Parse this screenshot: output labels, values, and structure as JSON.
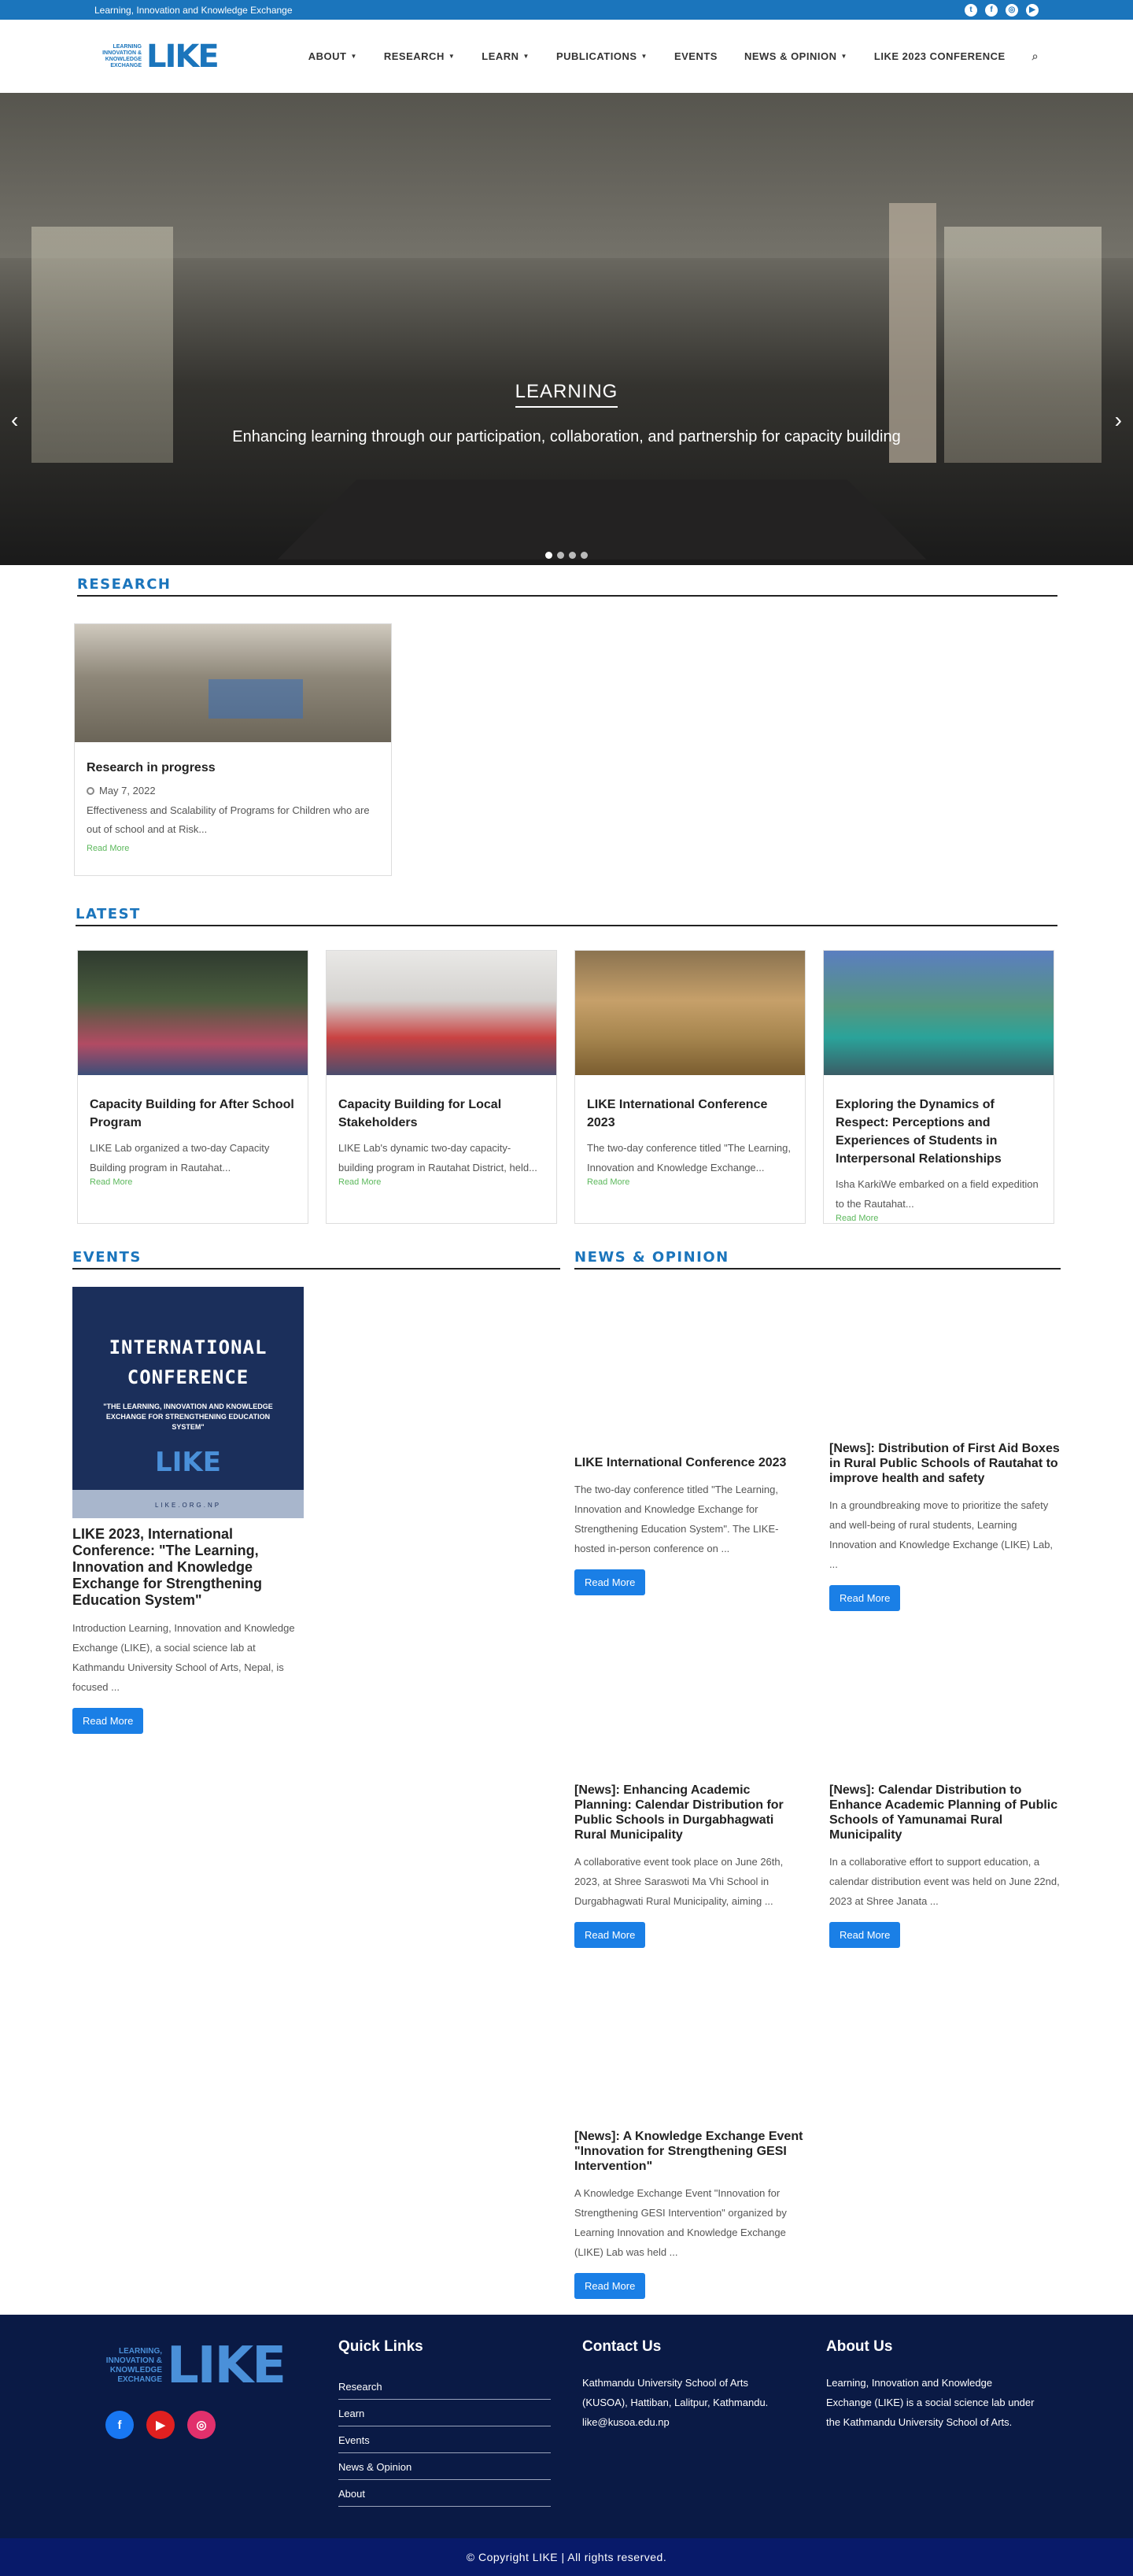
{
  "topbar": {
    "tagline": "Learning, Innovation and Knowledge Exchange",
    "socials": [
      "twitter-icon",
      "facebook-icon",
      "instagram-icon",
      "youtube-icon"
    ]
  },
  "header": {
    "logo_text": "LEARNING INNOVATION & KNOWLEDGE EXCHANGE",
    "logo_mark": "LIKE",
    "nav": [
      {
        "label": "ABOUT",
        "caret": true
      },
      {
        "label": "RESEARCH",
        "caret": true
      },
      {
        "label": "LEARN",
        "caret": true
      },
      {
        "label": "PUBLICATIONS",
        "caret": true
      },
      {
        "label": "EVENTS",
        "caret": false
      },
      {
        "label": "NEWS & OPINION",
        "caret": true
      },
      {
        "label": "LIKE 2023 CONFERENCE",
        "caret": false
      }
    ]
  },
  "hero": {
    "title": "LEARNING",
    "subtitle": "Enhancing learning through our participation, collaboration, and partnership for capacity building",
    "slides": 4,
    "active_slide": 1
  },
  "research": {
    "heading": "RESEARCH",
    "card": {
      "title": "Research in progress",
      "date": "May 7, 2022",
      "excerpt": "Effectiveness and Scalability of Programs for Children who are out of school and at Risk...",
      "read_more": "Read More"
    }
  },
  "latest": {
    "heading": "LATEST",
    "cards": [
      {
        "title": "Capacity Building for After School Program",
        "excerpt": "LIKE Lab organized a two-day Capacity Building program in Rautahat...",
        "read_more": "Read More"
      },
      {
        "title": "Capacity Building for Local Stakeholders",
        "excerpt": "LIKE Lab's dynamic two-day capacity-building program in Rautahat District, held...",
        "read_more": "Read More"
      },
      {
        "title": "LIKE International Conference 2023",
        "excerpt": "The two-day conference titled \"The Learning, Innovation and Knowledge Exchange...",
        "read_more": "Read More"
      },
      {
        "title": "Exploring the Dynamics of Respect: Perceptions and Experiences of Students in Interpersonal Relationships",
        "excerpt": "Isha KarkiWe embarked on a field expedition to the Rautahat...",
        "read_more": "Read More"
      }
    ]
  },
  "events": {
    "heading": "EVENTS",
    "poster": {
      "line1": "INTERNATIONAL",
      "line2": "CONFERENCE",
      "line3": "\"THE LEARNING, INNOVATION AND KNOWLEDGE EXCHANGE FOR STRENGTHENING EDUCATION SYSTEM\"",
      "mark": "LIKE",
      "url": "LIKE.ORG.NP"
    },
    "title": "LIKE 2023, International Conference: \"The Learning, Innovation and Knowledge Exchange for Strengthening Education System\"",
    "excerpt": "Introduction Learning, Innovation and Knowledge Exchange (LIKE), a social science lab at Kathmandu University School of Arts, Nepal, is focused ...",
    "button": "Read More"
  },
  "news": {
    "heading": "NEWS & OPINION",
    "items": [
      {
        "title": "LIKE International Conference 2023",
        "excerpt": "The two-day conference titled \"The Learning, Innovation and Knowledge Exchange for Strengthening Education System\". The LIKE-hosted in-person conference on ...",
        "button": "Read More"
      },
      {
        "title": "[News]: Distribution of First Aid Boxes in Rural Public Schools of Rautahat to improve health and safety",
        "excerpt": "In a groundbreaking move to prioritize the safety and well-being of rural students, Learning Innovation and Knowledge Exchange (LIKE) Lab, ...",
        "button": "Read More"
      },
      {
        "title": "[News]: Enhancing Academic Planning: Calendar Distribution for Public Schools in Durgabhagwati Rural Municipality",
        "excerpt": "A collaborative event took place on June 26th, 2023, at Shree Saraswoti Ma Vhi School in Durgabhagwati Rural Municipality, aiming ...",
        "button": "Read More"
      },
      {
        "title": "[News]: Calendar Distribution to Enhance Academic Planning of Public Schools of Yamunamai Rural Municipality",
        "excerpt": "In a collaborative effort to support education, a calendar distribution event was held on June 22nd, 2023 at Shree Janata ...",
        "button": "Read More"
      },
      {
        "title": "[News]: A Knowledge Exchange Event \"Innovation for Strengthening GESI Intervention\"",
        "excerpt": "A Knowledge Exchange Event \"Innovation for Strengthening GESI Intervention\" organized by Learning Innovation and Knowledge Exchange (LIKE) Lab was held ...",
        "button": "Read More"
      }
    ]
  },
  "footer": {
    "logo_text": "LEARNING, INNOVATION & KNOWLEDGE EXCHANGE",
    "logo_mark": "LIKE",
    "social": [
      "facebook-icon",
      "youtube-icon",
      "instagram-icon"
    ],
    "quick_links_title": "Quick Links",
    "quick_links": [
      "Research",
      "Learn",
      "Events",
      "News & Opinion",
      "About"
    ],
    "contact_title": "Contact Us",
    "contact_text": "Kathmandu University School of Arts (KUSOA), Hattiban, Lalitpur, Kathmandu. like@kusoa.edu.np",
    "about_title": "About Us",
    "about_text": "Learning, Innovation and Knowledge Exchange (LIKE)  is a social science lab under the Kathmandu University School of Arts.",
    "copyright": "© Copyright LIKE | All rights reserved."
  },
  "colors": {
    "brand_blue": "#1b75bc",
    "button_blue": "#1a7fe6",
    "read_more_green": "#5cb85c",
    "footer_bg": "#0a1a45",
    "copyright_bg": "#081a6a"
  }
}
